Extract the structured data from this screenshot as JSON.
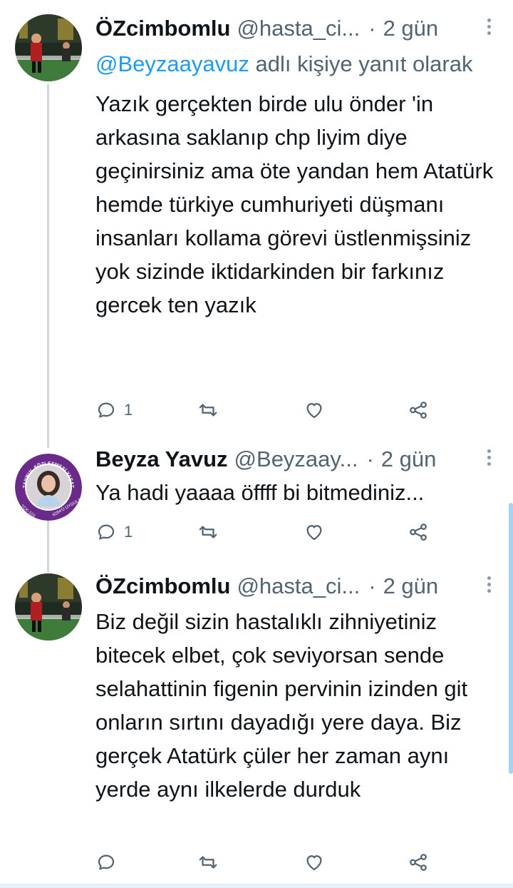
{
  "tweets": [
    {
      "name": "ÖZcimbomlu",
      "handle": "@hasta_ci...",
      "dot": "·",
      "time": "2 gün",
      "replying_prefix": "@Beyzaayavuz",
      "replying_suffix": " adlı kişiye yanıt olarak",
      "text": "Yazık gerçekten birde ulu önder 'in arkasına saklanıp chp liyim diye geçinirsiniz ama öte yandan hem Atatürk hemde türkiye cumhuriyeti düşmanı insanları kollama görevi üstlenmişsiniz yok sizinde iktidarkinden bir farkınız gercek ten yazık",
      "reply_count": "1"
    },
    {
      "name": "Beyza Yavuz",
      "handle": "@Beyzaay...",
      "dot": "·",
      "time": "2 gün",
      "text": "Ya hadi yaaaa öffff bi bitmediniz...",
      "reply_count": "1",
      "avatar_ring_text": "İSTANBUL SÖZLEŞMESİ YAŞATIR",
      "avatar_left_text": "TCK-103",
      "avatar_right_text": "6284'Ü UYGULA"
    },
    {
      "name": "ÖZcimbomlu",
      "handle": "@hasta_ci...",
      "dot": "·",
      "time": "2 gün",
      "text": "Biz değil sizin hastalıklı zihniyetiniz bitecek elbet, çok seviyorsan sende selahattinin figenin pervinin izinden git onların sırtını dayadığı yere daya. Biz gerçek Atatürk çüler her zaman aynı yerde aynı ilkelerde durduk",
      "reply_count": ""
    }
  ],
  "icons": {
    "reply": "reply-icon",
    "retweet": "retweet-icon",
    "like": "heart-icon",
    "share": "share-icon",
    "more": "more-vertical-icon"
  },
  "colors": {
    "text": "#0f1419",
    "secondary": "#536471",
    "link": "#1d9bf0",
    "thread_line": "#cfd9de",
    "avatar_ring": "#6a2a8a"
  }
}
